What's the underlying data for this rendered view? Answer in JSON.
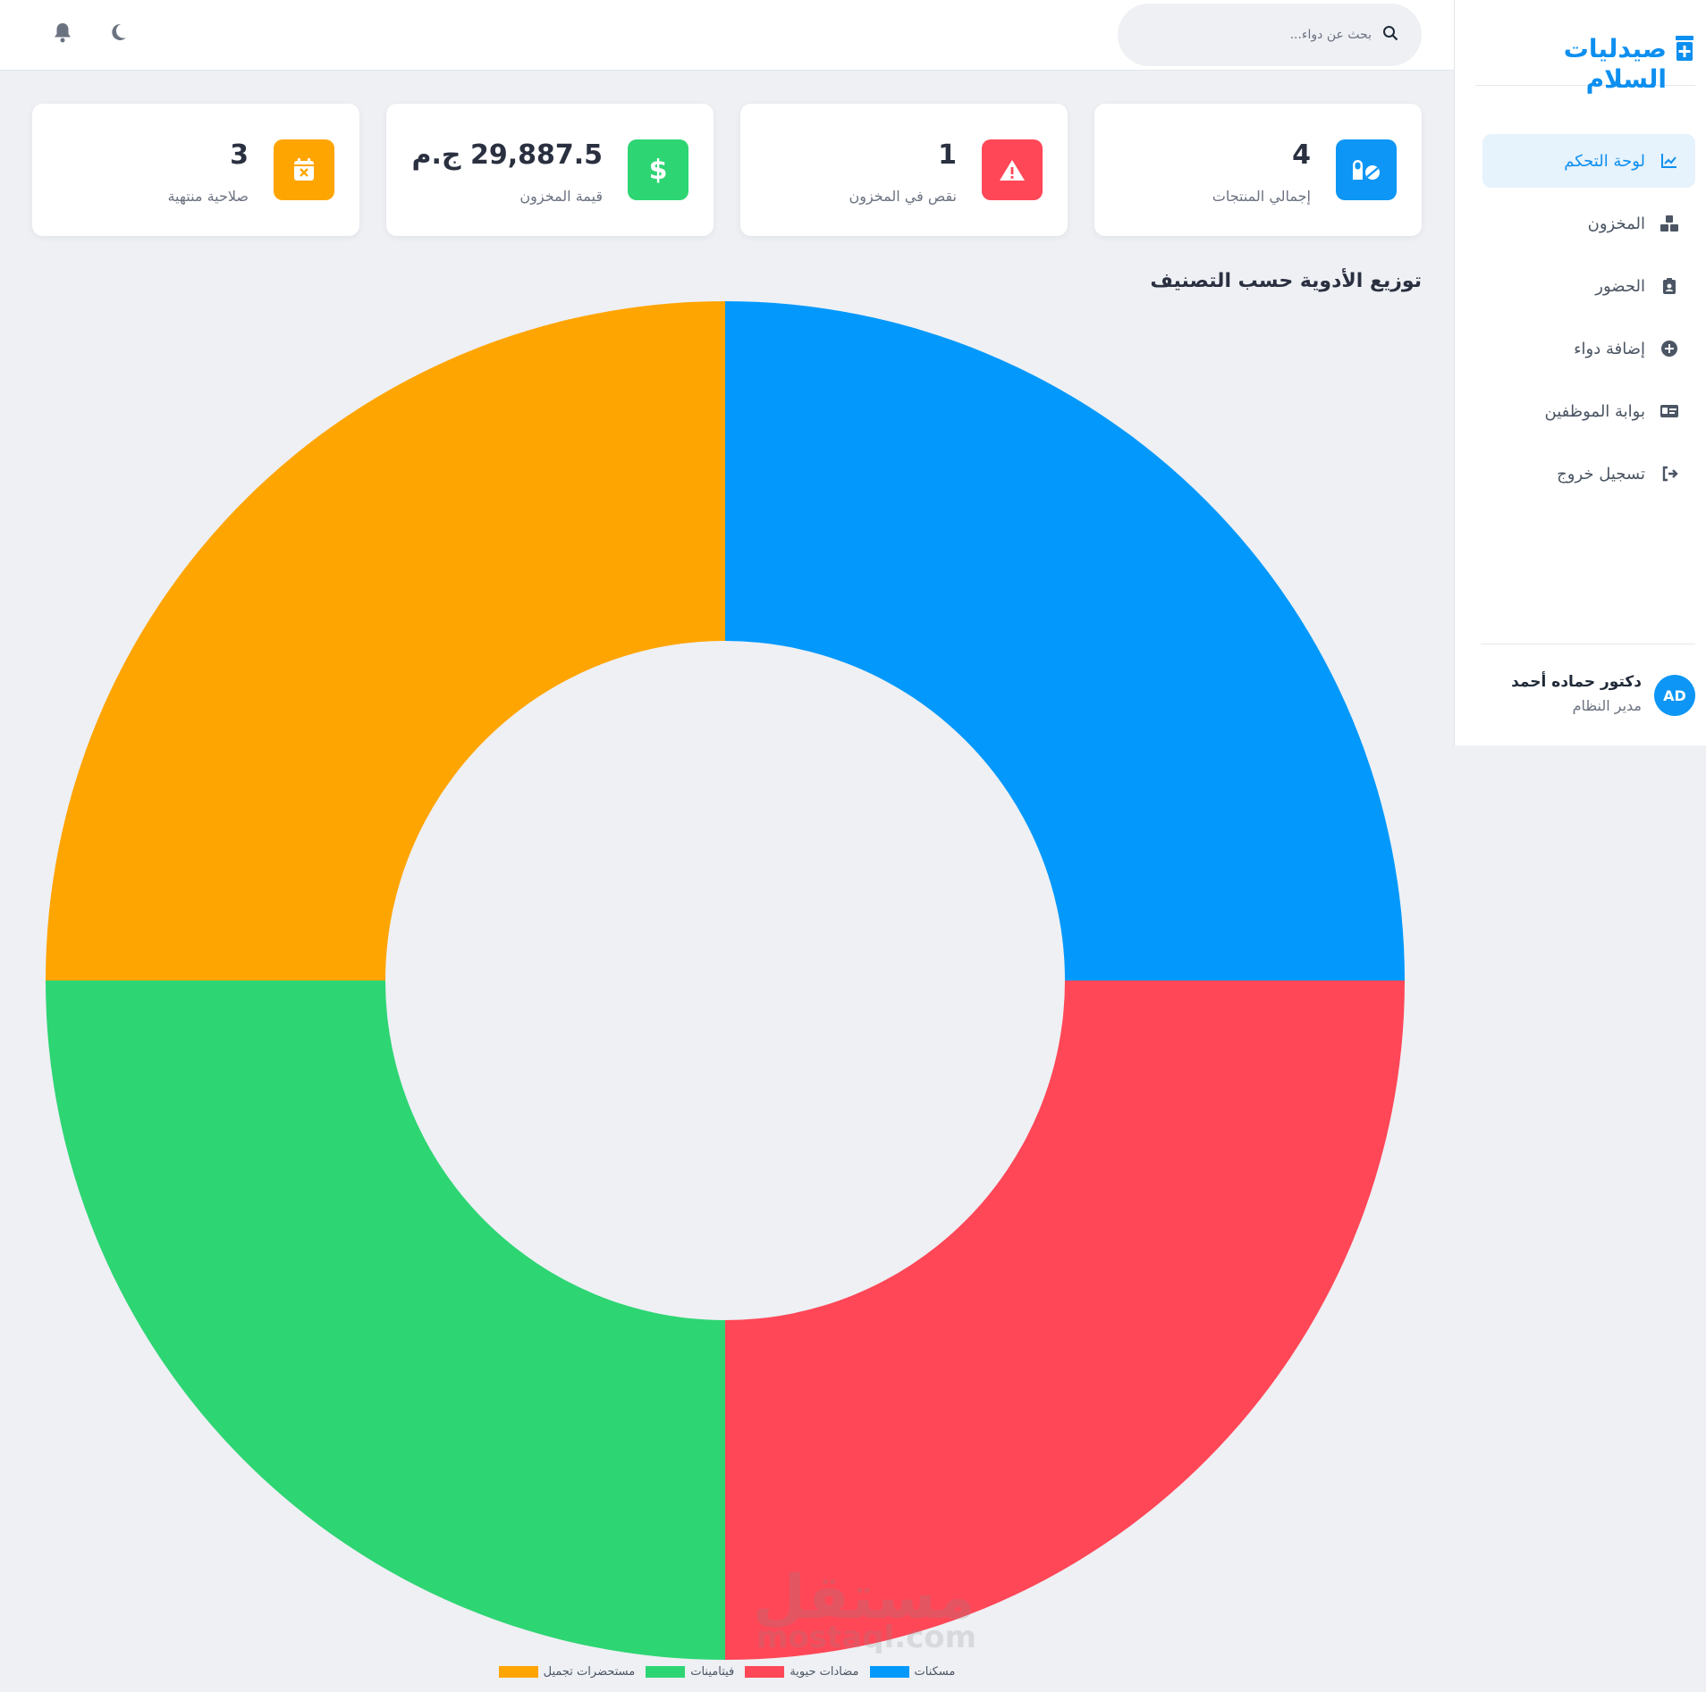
{
  "brand": {
    "name": "صيدليات السلام",
    "icon": "pharmacy-icon"
  },
  "search": {
    "placeholder": "بحث عن دواء..."
  },
  "topbar": {
    "icons": [
      "bell-icon",
      "moon-icon"
    ]
  },
  "nav": {
    "items": [
      {
        "label": "لوحة التحكم",
        "icon": "chart-line-icon",
        "active": true
      },
      {
        "label": "المخزون",
        "icon": "boxes-icon",
        "active": false
      },
      {
        "label": "الحضور",
        "icon": "clipboard-user-icon",
        "active": false
      },
      {
        "label": "إضافة دواء",
        "icon": "plus-circle-icon",
        "active": false
      },
      {
        "label": "بوابة الموظفين",
        "icon": "id-card-icon",
        "active": false
      },
      {
        "label": "تسجيل خروج",
        "icon": "logout-icon",
        "active": false
      }
    ]
  },
  "user": {
    "initials": "AD",
    "name": "دكتور حماده أحمد",
    "role": "مدير النظام"
  },
  "stats": [
    {
      "value": "4",
      "label": "إجمالي المنتجات",
      "icon": "pills-icon",
      "color": "#0d96f5"
    },
    {
      "value": "1",
      "label": "نقص في المخزون",
      "icon": "warning-icon",
      "color": "#ff4757"
    },
    {
      "value": "29,887.5 ج.م",
      "label": "قيمة المخزون",
      "icon": "dollar-icon",
      "color": "#2ed573"
    },
    {
      "value": "3",
      "label": "صلاحية منتهية",
      "icon": "calendar-x-icon",
      "color": "#ffa502"
    }
  ],
  "chart": {
    "title": "توزيع الأدوية حسب التصنيف"
  },
  "chart_data": {
    "type": "pie",
    "variant": "doughnut",
    "categories": [
      "مسكنات",
      "مضادات حيوية",
      "فيتامينات",
      "مستحضرات تجميل"
    ],
    "values": [
      1,
      1,
      1,
      1
    ],
    "colors": [
      "#0399fc",
      "#ff4757",
      "#2ed573",
      "#ffa502"
    ],
    "legend": "bottom"
  },
  "watermark": {
    "main": "مستقل",
    "sub": "mostaql.com"
  }
}
